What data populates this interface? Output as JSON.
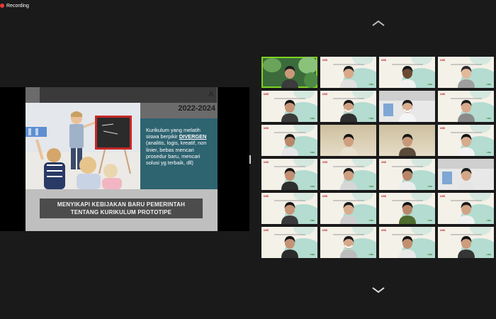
{
  "recording": {
    "label": "Recording",
    "color": "#e53935"
  },
  "nav": {
    "up_icon": "chevron-up-icon",
    "down_icon": "chevron-down-icon"
  },
  "slide": {
    "title_tail": "A",
    "year": "2022-2024",
    "text_before": "Kurikulum yang melatih siswa berpikir ",
    "text_highlight": "DIVERGEN",
    "text_after": " (analitis, logis, kreatif, non linier, bebas mencari prosedur baru, mencari solusi yg terbaik, dll)",
    "banner_line1": "MENYIKAPI KEBIJAKAN BARU PEMERINTAH",
    "banner_line2": "TENTANG KURIKULUM PROTOTIPE",
    "teal_color": "#2e6370"
  },
  "gallery": {
    "tile_logo": "UNS",
    "tile_foot": "UNS",
    "accent": "#7ed321",
    "participants": [
      {
        "kind": "green",
        "skin": "#c99a7a",
        "hair": "#1d1d1d",
        "shirt": "#3b3b3b",
        "active": true
      },
      {
        "kind": "bg",
        "skin": "#d8a98a",
        "hair": "#1a1a1a",
        "shirt": "#e0e0e0"
      },
      {
        "kind": "bg",
        "skin": "#6d4a34",
        "hair": "#151515",
        "shirt": "#f1f1f1"
      },
      {
        "kind": "bg",
        "skin": "#e3b99b",
        "hair": "#2b2b2b",
        "shirt": "#9e9e9e"
      },
      {
        "kind": "bg",
        "skin": "#c69577",
        "hair": "#111111",
        "shirt": "#3b3b3b"
      },
      {
        "kind": "bg",
        "skin": "#cfa183",
        "hair": "#141414",
        "shirt": "#2f2f2f",
        "mask": true
      },
      {
        "kind": "office",
        "skin": "#d9ae90",
        "hair": "#1a1a1a",
        "shirt": "#f5f5f5",
        "mask": true
      },
      {
        "kind": "bg",
        "skin": "#d8a98a",
        "hair": "#1c1c1c",
        "shirt": "#8a8a8a"
      },
      {
        "kind": "bg",
        "skin": "#b9876a",
        "hair": "#151515",
        "shirt": "#e6e6e6"
      },
      {
        "kind": "beige",
        "skin": "#cf9f80",
        "hair": "#101010",
        "shirt": "#e9e1cf"
      },
      {
        "kind": "beige",
        "skin": "#c9987a",
        "hair": "#161616",
        "shirt": "#5a4a3a"
      },
      {
        "kind": "bg",
        "skin": "#d7ab8e",
        "hair": "#141414",
        "shirt": "#f3f3f3"
      },
      {
        "kind": "bg",
        "skin": "#c28f72",
        "hair": "#181818",
        "shirt": "#2d2d2d"
      },
      {
        "kind": "bg",
        "skin": "#cf9f80",
        "hair": "#1a1a1a",
        "shirt": "#d6d6d6"
      },
      {
        "kind": "bg",
        "skin": "#b88569",
        "hair": "#151515",
        "shirt": "#ececec"
      },
      {
        "kind": "office",
        "skin": "#d3a688",
        "hair": "#1d1d1d",
        "shirt": "#e5e5e5"
      },
      {
        "kind": "bg",
        "skin": "#c69577",
        "hair": "#161616",
        "shirt": "#3a3a3a"
      },
      {
        "kind": "bg",
        "skin": "#d9ad8f",
        "hair": "#1b1b1b",
        "shirt": "#cfcfcf"
      },
      {
        "kind": "bg",
        "skin": "#b98669",
        "hair": "#121212",
        "shirt": "#4f6b2f"
      },
      {
        "kind": "bg",
        "skin": "#d1a385",
        "hair": "#191919",
        "shirt": "#f0f0f0"
      },
      {
        "kind": "bg",
        "skin": "#c49376",
        "hair": "#151515",
        "shirt": "#2b2b2b"
      },
      {
        "kind": "bg",
        "skin": "#d5a889",
        "hair": "#1a1a1a",
        "shirt": "#bdbdbd",
        "mask": true
      },
      {
        "kind": "bg",
        "skin": "#c1906f",
        "hair": "#161616",
        "shirt": "#e9e9e9"
      },
      {
        "kind": "bg",
        "skin": "#cc9c7d",
        "hair": "#141414",
        "shirt": "#353535"
      }
    ]
  }
}
